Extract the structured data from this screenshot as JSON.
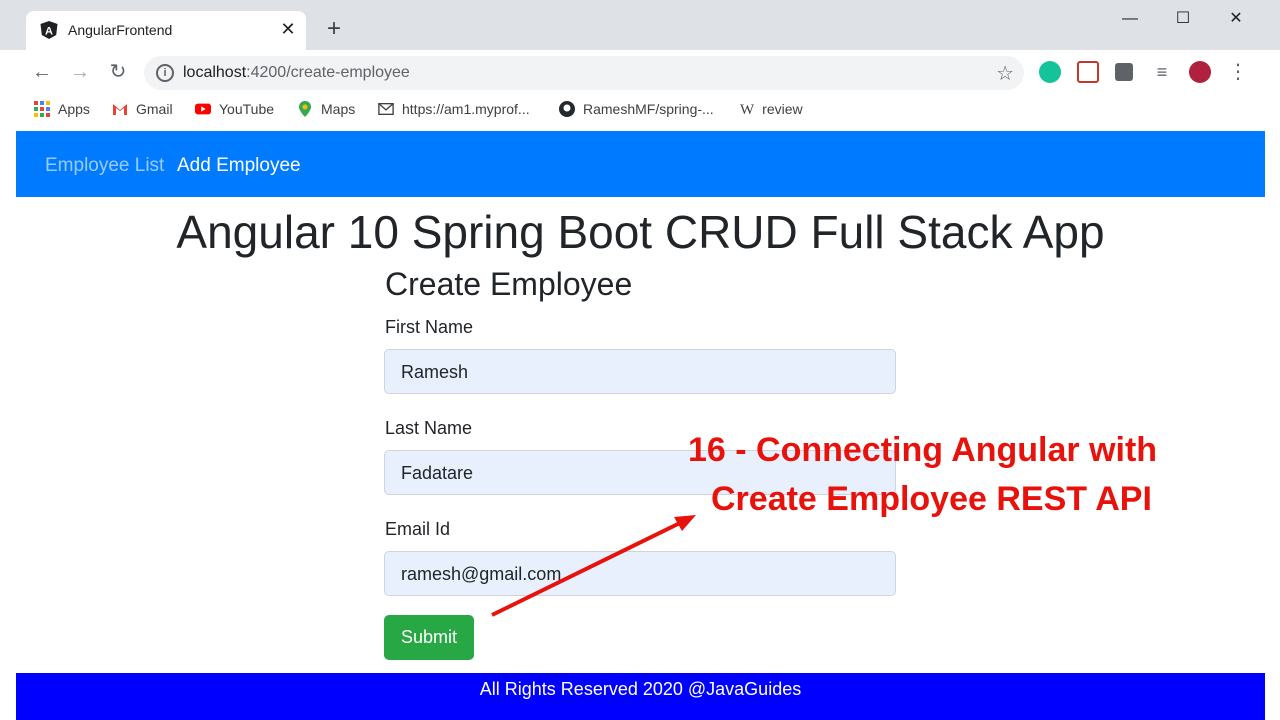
{
  "browser": {
    "tab_title": "AngularFrontend",
    "url_host": "localhost",
    "url_rest": ":4200/create-employee",
    "bookmarks": [
      {
        "label": "Apps",
        "icon": "apps-grid-icon"
      },
      {
        "label": "Gmail",
        "icon": "gmail-icon"
      },
      {
        "label": "YouTube",
        "icon": "youtube-icon"
      },
      {
        "label": "Maps",
        "icon": "maps-pin-icon"
      },
      {
        "label": "https://am1.myprof...",
        "icon": "mail-envelope-icon"
      },
      {
        "label": "RameshMF/spring-...",
        "icon": "github-icon"
      },
      {
        "label": "review",
        "icon": "wikipedia-icon"
      }
    ]
  },
  "navbar": {
    "link_list": "Employee List",
    "link_add": "Add Employee"
  },
  "page": {
    "title": "Angular 10 Spring Boot CRUD Full Stack App",
    "form_title": "Create Employee"
  },
  "form": {
    "first_name_label": "First Name",
    "first_name_value": "Ramesh",
    "last_name_label": "Last Name",
    "last_name_value": "Fadatare",
    "email_label": "Email Id",
    "email_value": "ramesh@gmail.com",
    "submit_label": "Submit"
  },
  "footer": {
    "text": "All Rights Reserved 2020 @JavaGuides"
  },
  "overlay": {
    "line1": "16 - Connecting Angular with",
    "line2": "Create Employee REST API"
  },
  "colors": {
    "navbar": "#007bff",
    "footer": "#0000ff",
    "submit": "#28a745",
    "caption": "#e8120c"
  }
}
